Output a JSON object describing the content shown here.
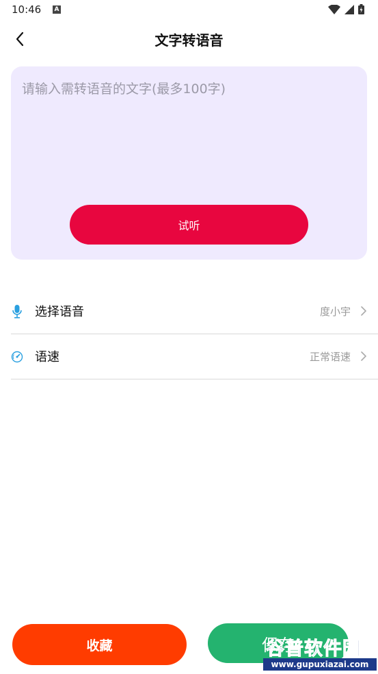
{
  "status_bar": {
    "time": "10:46",
    "notification_glyph": "A",
    "icons": [
      "wifi-icon",
      "signal-icon",
      "battery-icon"
    ]
  },
  "nav": {
    "title": "文字转语音",
    "back_icon": "back-arrow-icon"
  },
  "text_card": {
    "placeholder": "请输入需转语音的文字(最多100字)",
    "value": "",
    "listen_label": "试听"
  },
  "settings": {
    "voice": {
      "label": "选择语音",
      "value": "度小宇",
      "icon": "microphone-icon"
    },
    "speed": {
      "label": "语速",
      "value": "正常语速",
      "icon": "speedometer-icon"
    }
  },
  "bottom": {
    "favorite_label": "收藏",
    "save_label": "保存"
  },
  "watermark": {
    "title": "谷普软件园",
    "url": "www.gupuxiazai.com"
  },
  "colors": {
    "card_bg": "#efeafe",
    "listen_button": "#e8063f",
    "favorite_button": "#ff3c00",
    "save_button": "#24b36f",
    "accent_icon": "#2aa0e0"
  }
}
